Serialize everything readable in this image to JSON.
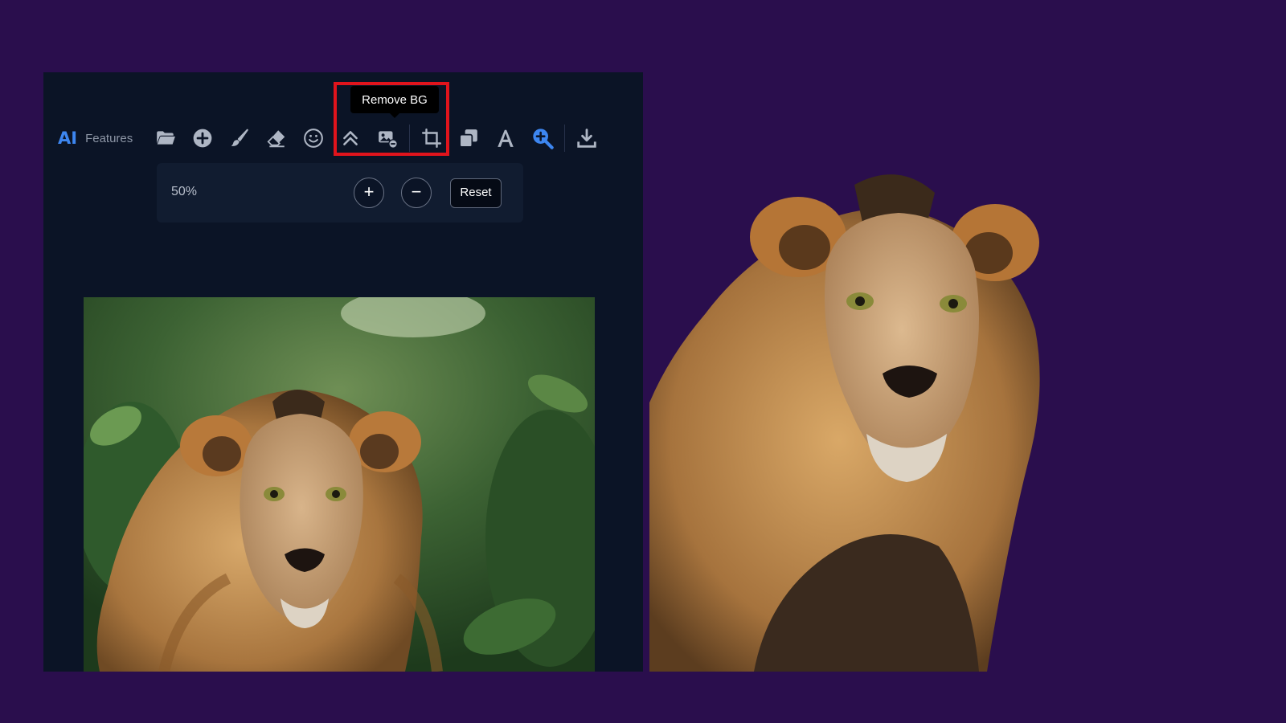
{
  "toolbar": {
    "ai_badge": "AI",
    "features_label": "Features",
    "tools": [
      {
        "icon": "folder-icon"
      },
      {
        "icon": "add-circle-icon"
      },
      {
        "icon": "brush-icon"
      },
      {
        "icon": "eraser-icon"
      },
      {
        "icon": "emoji-icon"
      },
      {
        "icon": "double-chevron-up-icon"
      },
      {
        "icon": "remove-bg-icon",
        "tooltip": "Remove BG",
        "highlighted": true
      },
      {
        "icon": "crop-icon"
      },
      {
        "icon": "layers-icon"
      },
      {
        "icon": "text-icon"
      },
      {
        "icon": "zoom-in-icon",
        "active": true
      },
      {
        "icon": "download-icon"
      }
    ],
    "tooltip_text": "Remove BG"
  },
  "zoom_panel": {
    "value": "50%",
    "zoom_in_label": "+",
    "zoom_out_label": "−",
    "reset_label": "Reset"
  },
  "colors": {
    "page_background": "#2a0e4d",
    "editor_background": "#0b1426",
    "accent": "#3d86f0",
    "highlight": "#e0141c",
    "icon": "#aeb6c4"
  }
}
